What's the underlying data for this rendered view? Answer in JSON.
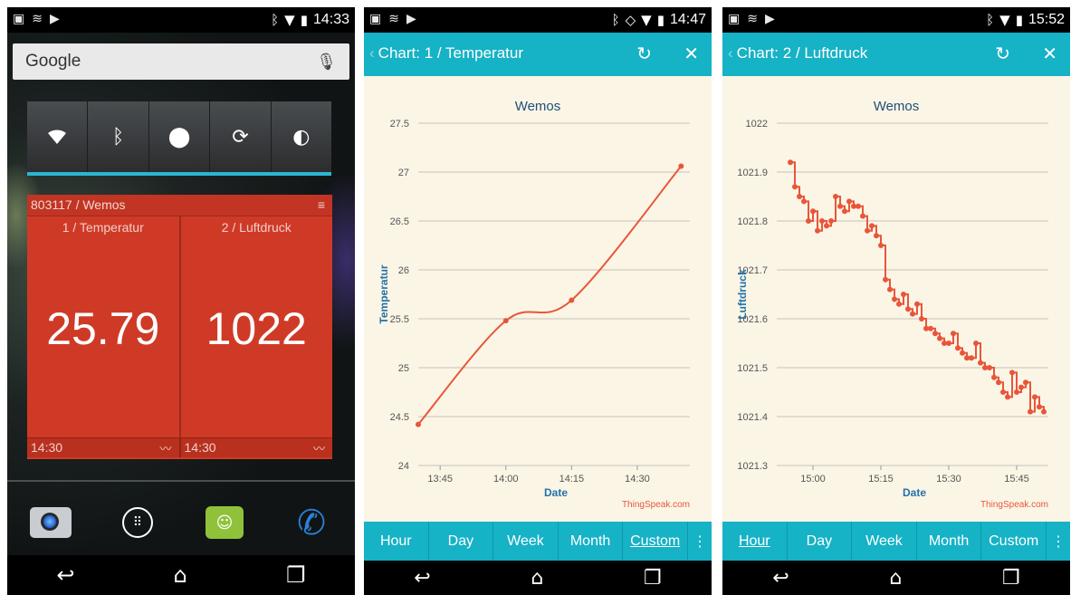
{
  "status": {
    "phone1_time": "14:33",
    "phone2_time": "14:47",
    "phone3_time": "15:52"
  },
  "home": {
    "search_label": "Google",
    "widget": {
      "header": "803117 / Wemos",
      "fields": [
        {
          "label": "1 / Temperatur",
          "value": "25.79",
          "time": "14:30"
        },
        {
          "label": "2 / Luftdruck",
          "value": "1022",
          "time": "14:30"
        }
      ]
    }
  },
  "charts": [
    {
      "app_title": "Chart: 1 / Temperatur",
      "tabs": [
        "Hour",
        "Day",
        "Week",
        "Month",
        "Custom"
      ],
      "selected_tab": "Custom",
      "chart_data": {
        "type": "line",
        "title": "Wemos",
        "xlabel": "Date",
        "ylabel": "Temperatur",
        "credit": "ThingSpeak.com",
        "color": "#e8563a",
        "ylim": [
          24,
          27.5
        ],
        "yticks": [
          "24",
          "24.5",
          "25",
          "25.5",
          "26",
          "26.5",
          "27",
          "27.5"
        ],
        "xlim": [
          "13:40",
          "14:42"
        ],
        "xticks": [
          "13:45",
          "14:00",
          "14:15",
          "14:30"
        ],
        "series": [
          {
            "x": [
              "13:40",
              "14:00",
              "14:15",
              "14:40"
            ],
            "y": [
              24.42,
              25.48,
              25.69,
              27.06
            ]
          }
        ]
      }
    },
    {
      "app_title": "Chart: 2 / Luftdruck",
      "tabs": [
        "Hour",
        "Day",
        "Week",
        "Month",
        "Custom"
      ],
      "selected_tab": "Hour",
      "chart_data": {
        "type": "line",
        "title": "Wemos",
        "xlabel": "Date",
        "ylabel": "Luftdruck",
        "credit": "ThingSpeak.com",
        "color": "#e8563a",
        "ylim": [
          1021.3,
          1022
        ],
        "yticks": [
          "1021.3",
          "1021.4",
          "1021.5",
          "1021.6",
          "1021.7",
          "1021.8",
          "1021.9",
          "1022"
        ],
        "xlim": [
          "14:52",
          "15:52"
        ],
        "xticks": [
          "15:00",
          "15:15",
          "15:30",
          "15:45"
        ],
        "series": [
          {
            "x": [
              "14:55",
              "14:56",
              "14:57",
              "14:58",
              "14:59",
              "15:00",
              "15:01",
              "15:02",
              "15:03",
              "15:04",
              "15:05",
              "15:06",
              "15:07",
              "15:08",
              "15:09",
              "15:10",
              "15:11",
              "15:12",
              "15:13",
              "15:14",
              "15:15",
              "15:16",
              "15:17",
              "15:18",
              "15:19",
              "15:20",
              "15:21",
              "15:22",
              "15:23",
              "15:24",
              "15:25",
              "15:26",
              "15:27",
              "15:28",
              "15:29",
              "15:30",
              "15:31",
              "15:32",
              "15:33",
              "15:34",
              "15:35",
              "15:36",
              "15:37",
              "15:38",
              "15:39",
              "15:40",
              "15:41",
              "15:42",
              "15:43",
              "15:44",
              "15:45",
              "15:46",
              "15:47",
              "15:48",
              "15:49",
              "15:50",
              "15:51"
            ],
            "y": [
              1021.92,
              1021.87,
              1021.85,
              1021.84,
              1021.8,
              1021.82,
              1021.78,
              1021.8,
              1021.79,
              1021.8,
              1021.85,
              1021.83,
              1021.82,
              1021.84,
              1021.83,
              1021.83,
              1021.81,
              1021.78,
              1021.79,
              1021.77,
              1021.75,
              1021.68,
              1021.66,
              1021.64,
              1021.63,
              1021.65,
              1021.62,
              1021.61,
              1021.63,
              1021.6,
              1021.58,
              1021.58,
              1021.57,
              1021.56,
              1021.55,
              1021.55,
              1021.57,
              1021.54,
              1021.53,
              1021.52,
              1021.52,
              1021.55,
              1021.51,
              1021.5,
              1021.5,
              1021.48,
              1021.47,
              1021.45,
              1021.44,
              1021.49,
              1021.45,
              1021.46,
              1021.47,
              1021.41,
              1021.44,
              1021.42,
              1021.41
            ]
          }
        ]
      }
    }
  ]
}
